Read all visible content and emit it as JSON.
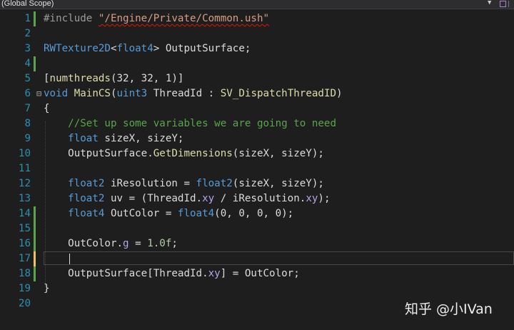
{
  "scope_bar": {
    "label": "(Global Scope)",
    "dropdown_glyph": "▼"
  },
  "editor": {
    "lines": [
      {
        "n": "1",
        "change": "green",
        "tokens": [
          [
            "pp",
            "#include "
          ],
          [
            "str squig",
            "\"/Engine/Private/Common.ush\""
          ]
        ]
      },
      {
        "n": "2",
        "change": "",
        "tokens": []
      },
      {
        "n": "3",
        "change": "",
        "tokens": [
          [
            "ty",
            "RWTexture2D"
          ],
          [
            "var",
            "<"
          ],
          [
            "ty",
            "float4"
          ],
          [
            "var",
            "> OutputSurface;"
          ]
        ]
      },
      {
        "n": "4",
        "change": "green",
        "tokens": []
      },
      {
        "n": "5",
        "change": "",
        "tokens": [
          [
            "var",
            "["
          ],
          [
            "fn",
            "numthreads"
          ],
          [
            "var",
            "(32, 32, 1)]"
          ]
        ]
      },
      {
        "n": "6",
        "change": "",
        "fold": "⊟",
        "tokens": [
          [
            "ty",
            "void"
          ],
          [
            "var",
            " "
          ],
          [
            "fn",
            "MainCS"
          ],
          [
            "var",
            "("
          ],
          [
            "ty",
            "uint3"
          ],
          [
            "var",
            " ThreadId : "
          ],
          [
            "fn",
            "SV_DispatchThreadID"
          ],
          [
            "var",
            ")"
          ]
        ]
      },
      {
        "n": "7",
        "change": "",
        "tokens": [
          [
            "var",
            "{"
          ]
        ]
      },
      {
        "n": "8",
        "change": "",
        "tokens": [
          [
            "var",
            "    "
          ],
          [
            "cm",
            "//Set up some variables we are going to need"
          ]
        ]
      },
      {
        "n": "9",
        "change": "",
        "tokens": [
          [
            "var",
            "    "
          ],
          [
            "ty",
            "float"
          ],
          [
            "var",
            " sizeX, sizeY;"
          ]
        ]
      },
      {
        "n": "10",
        "change": "",
        "tokens": [
          [
            "var",
            "    OutputSurface."
          ],
          [
            "fn",
            "GetDimensions"
          ],
          [
            "var",
            "(sizeX, sizeY);"
          ]
        ]
      },
      {
        "n": "11",
        "change": "",
        "tokens": []
      },
      {
        "n": "12",
        "change": "",
        "tokens": [
          [
            "var",
            "    "
          ],
          [
            "ty",
            "float2"
          ],
          [
            "var",
            " iResolution = "
          ],
          [
            "ty",
            "float2"
          ],
          [
            "var",
            "(sizeX, sizeY);"
          ]
        ]
      },
      {
        "n": "13",
        "change": "",
        "tokens": [
          [
            "var",
            "    "
          ],
          [
            "ty",
            "float2"
          ],
          [
            "var",
            " uv = (ThreadId."
          ],
          [
            "pur",
            "xy"
          ],
          [
            "var",
            " / iResolution."
          ],
          [
            "pur",
            "xy"
          ],
          [
            "var",
            ");"
          ]
        ]
      },
      {
        "n": "14",
        "change": "green",
        "tokens": [
          [
            "var",
            "    "
          ],
          [
            "ty",
            "float4"
          ],
          [
            "var",
            " OutColor = "
          ],
          [
            "ty",
            "float4"
          ],
          [
            "var",
            "(0, 0, 0, 0);"
          ]
        ]
      },
      {
        "n": "15",
        "change": "green",
        "tokens": []
      },
      {
        "n": "16",
        "change": "green",
        "tokens": [
          [
            "var",
            "    OutColor."
          ],
          [
            "pur",
            "g"
          ],
          [
            "var",
            " = "
          ],
          [
            "num",
            "1.0f"
          ],
          [
            "var",
            ";"
          ]
        ]
      },
      {
        "n": "17",
        "change": "yellow",
        "current": true,
        "tokens": []
      },
      {
        "n": "18",
        "change": "green",
        "tokens": [
          [
            "var",
            "    OutputSurface[ThreadId."
          ],
          [
            "pur",
            "xy"
          ],
          [
            "var",
            "] = OutColor;"
          ]
        ]
      },
      {
        "n": "19",
        "change": "",
        "tokens": [
          [
            "var",
            "}"
          ]
        ]
      },
      {
        "n": "20",
        "change": "",
        "tokens": []
      }
    ]
  },
  "watermark": {
    "text": "知乎 @小IVan"
  }
}
